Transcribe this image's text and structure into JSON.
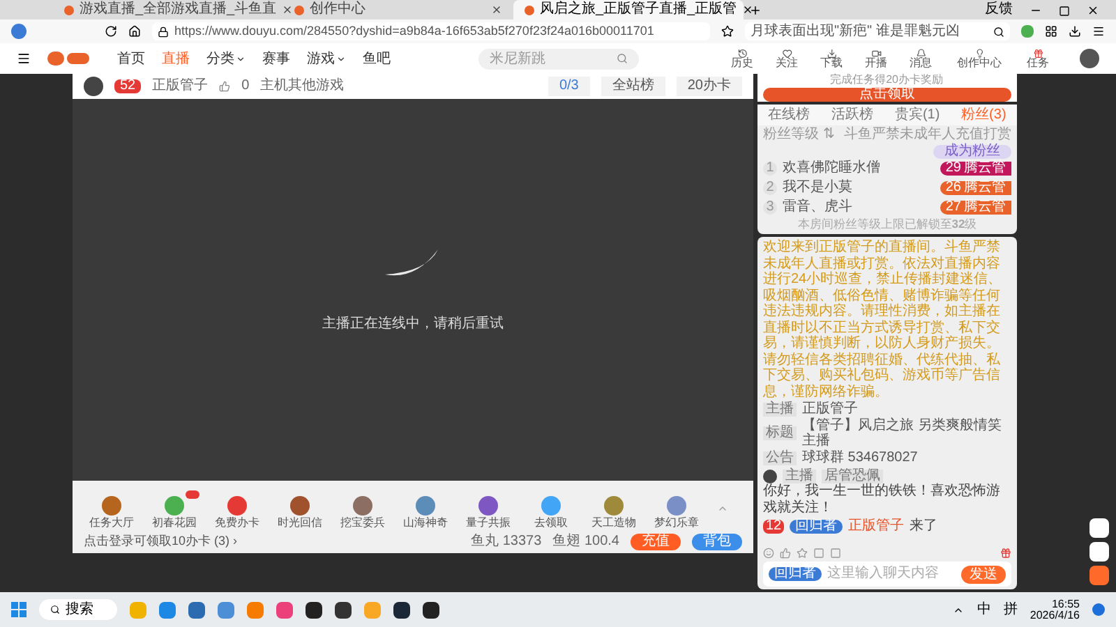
{
  "browser": {
    "tabs": [
      {
        "title": "游戏直播_全部游戏直播_斗鱼直",
        "selected": false
      },
      {
        "title": "创作中心",
        "selected": false
      },
      {
        "title": "风启之旅_正版管子直播_正版管",
        "selected": true
      }
    ],
    "url": "https://www.douyu.com/284550?dyshid=a9b84a-16f653ab5f270f23f24a016b00011701",
    "search_hint": "月球表面出现\"新疤\" 谁是罪魁元凶",
    "feedback": "反馈"
  },
  "site_nav": {
    "items": [
      {
        "label": "首页",
        "selected": false,
        "dropdown": false
      },
      {
        "label": "直播",
        "selected": true,
        "dropdown": false
      },
      {
        "label": "分类",
        "selected": false,
        "dropdown": true
      },
      {
        "label": "赛事",
        "selected": false,
        "dropdown": false
      },
      {
        "label": "游戏",
        "selected": false,
        "dropdown": true
      },
      {
        "label": "鱼吧",
        "selected": false,
        "dropdown": false
      }
    ],
    "search": {
      "placeholder": "米尼新跳"
    },
    "actions": [
      {
        "kind": "history",
        "label": "历史"
      },
      {
        "kind": "follow",
        "label": "关注"
      },
      {
        "kind": "download",
        "label": "下载"
      },
      {
        "kind": "live",
        "label": "开播"
      },
      {
        "kind": "bell",
        "label": "消息"
      },
      {
        "kind": "bulb",
        "label": "创作中心"
      },
      {
        "kind": "gift",
        "label": "任务"
      }
    ]
  },
  "streamer": {
    "name": "正版管子",
    "level": "52",
    "likes": "0",
    "category": "主机其他游戏",
    "rank_count": "0/3",
    "rank_label": "全站榜",
    "card_label": "20办卡"
  },
  "player": {
    "status": "主播正在连线中，请稍后重试"
  },
  "gifts": [
    {
      "label": "任务大厅",
      "color": "#b5651d",
      "new": false
    },
    {
      "label": "初春花园",
      "color": "#4caf50",
      "new": true
    },
    {
      "label": "免费办卡",
      "color": "#e53935",
      "new": false
    },
    {
      "label": "时光回信",
      "color": "#a0522d",
      "new": false
    },
    {
      "label": "挖宝委兵",
      "color": "#8d6e63",
      "new": false
    },
    {
      "label": "山海神奇",
      "color": "#5c8db8",
      "new": false
    },
    {
      "label": "量子共振",
      "color": "#7e57c2",
      "new": false
    },
    {
      "label": "去领取",
      "color": "#42a5f5",
      "new": false
    },
    {
      "label": "天工造物",
      "color": "#9e8a3a",
      "new": false
    },
    {
      "label": "梦幻乐章",
      "color": "#7b8fc7",
      "new": false
    }
  ],
  "gift_footer": {
    "login_hint": "点击登录可领取10办卡 (3) ›",
    "fish_balls": "鱼丸 13373",
    "fish_fins": "鱼翅 100.4",
    "recharge": "充值",
    "backpack": "背包"
  },
  "promo": {
    "text": "完成任务得20办卡奖励",
    "button": "点击领取"
  },
  "rank": {
    "tabs": [
      {
        "label": "在线榜",
        "selected": false
      },
      {
        "label": "活跃榜",
        "selected": false
      },
      {
        "label": "贵宾(1)",
        "selected": false
      },
      {
        "label": "粉丝(3)",
        "selected": true
      }
    ],
    "sub": {
      "sort": "粉丝等级 ⇅",
      "notice": "斗鱼严禁未成年人充值打赏",
      "join": "成为粉丝"
    },
    "fans": [
      {
        "rank": "1",
        "name": "欢喜佛陀睡水僧",
        "level": "29",
        "badge": "腾云管",
        "color": "#c2185b"
      },
      {
        "rank": "2",
        "name": "我不是小莫",
        "level": "26",
        "badge": "腾云管",
        "color": "#e8622a"
      },
      {
        "rank": "3",
        "name": "雷音、虎斗",
        "level": "27",
        "badge": "腾云管",
        "color": "#e8622a"
      }
    ],
    "footer": "本房间粉丝等级上限已解锁至**32**级"
  },
  "notice": "欢迎来到正版管子的直播间。斗鱼严禁未成年人直播或打赏。依法对直播内容进行24小时巡查，禁止传播封建迷信、吸烟酗酒、低俗色情、赌博诈骗等任何违法违规内容。请理性消费，如主播在直播时以不正当方式诱导打赏、私下交易，请谨慎判断，以防人身财产损失。请勿轻信各类招聘征婚、代练代抽、私下交易、购买礼包码、游戏币等广告信息，谨防网络诈骗。",
  "room_info": [
    {
      "label": "主播",
      "value": "正版管子"
    },
    {
      "label": "标题",
      "value": "【管子】风启之旅 另类爽般情笑主播"
    },
    {
      "label": "公告",
      "value": "球球群 534678027"
    }
  ],
  "chat": [
    {
      "kind": "message",
      "role": "主播",
      "name": "居管恐佩",
      "text": "你好，我一生一世的铁铁！喜欢恐怖游戏就关注！"
    },
    {
      "kind": "enter",
      "level": "12",
      "badge": "回归者",
      "name": "正版管子",
      "text": "来了"
    }
  ],
  "chat_input": {
    "badge": "回归者",
    "placeholder": "这里输入聊天内容",
    "send": "发送"
  },
  "taskbar": {
    "search": "搜索",
    "ime": [
      "中",
      "拼"
    ],
    "time": "16:55",
    "date": "2026/4/16"
  }
}
